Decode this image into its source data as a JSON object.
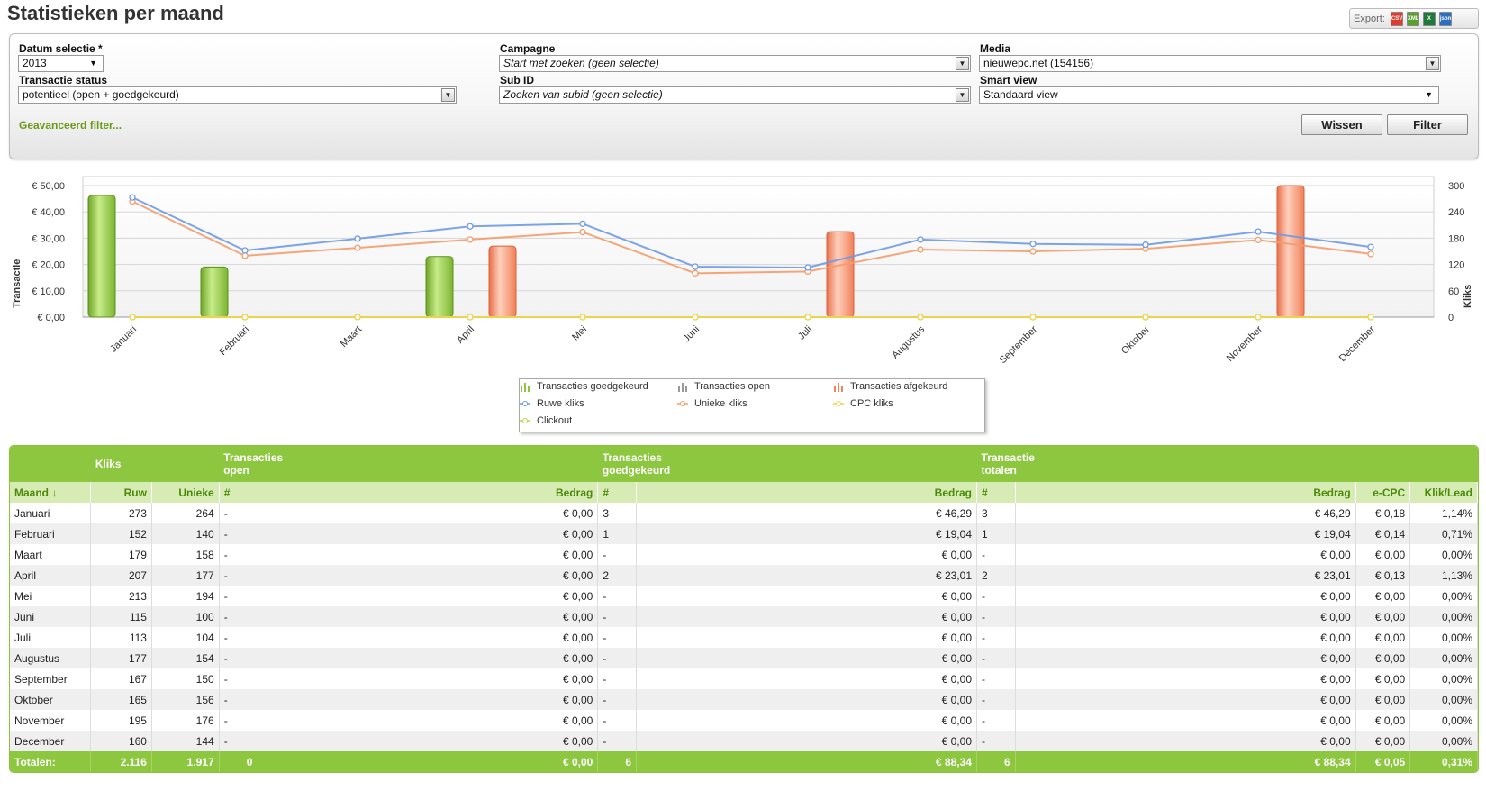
{
  "header": {
    "title": "Statistieken per maand",
    "export_label": "Export:",
    "export_icons": [
      "CSV",
      "XML",
      "X",
      "json"
    ]
  },
  "filters": {
    "datum_label": "Datum selectie *",
    "datum_value": "2013",
    "transactie_label": "Transactie status",
    "transactie_value": "potentieel (open + goedgekeurd)",
    "campagne_label": "Campagne",
    "campagne_value": "Start met zoeken (geen selectie)",
    "subid_label": "Sub ID",
    "subid_value": "Zoeken van subid (geen selectie)",
    "media_label": "Media",
    "media_value": "nieuwepc.net (154156)",
    "smartview_label": "Smart view",
    "smartview_value": "Standaard view",
    "advanced_link": "Geavanceerd filter...",
    "clear_button": "Wissen",
    "filter_button": "Filter"
  },
  "chart_data": {
    "type": "bar",
    "categories": [
      "Januari",
      "Februari",
      "Maart",
      "April",
      "Mei",
      "Juni",
      "Juli",
      "Augustus",
      "September",
      "Oktober",
      "November",
      "December"
    ],
    "ylabel": "Transactie",
    "y2label": "Kliks",
    "ylim": [
      0,
      50
    ],
    "y2lim": [
      0,
      300
    ],
    "y_ticks": [
      "€ 0,00",
      "€ 10,00",
      "€ 20,00",
      "€ 30,00",
      "€ 40,00",
      "€ 50,00"
    ],
    "y2_ticks": [
      "0",
      "60",
      "120",
      "180",
      "240",
      "300"
    ],
    "grid": true,
    "legend_position": "bottom-center",
    "series": [
      {
        "name": "Transacties goedgekeurd",
        "kind": "bar",
        "axis": "left",
        "color": "#8dc63f",
        "values": [
          46.29,
          19.04,
          0,
          23.01,
          0,
          0,
          0,
          0,
          0,
          0,
          0,
          0
        ]
      },
      {
        "name": "Transacties open",
        "kind": "bar",
        "axis": "left",
        "color": "#999999",
        "values": [
          0,
          0,
          0,
          0,
          0,
          0,
          0,
          0,
          0,
          0,
          0,
          0
        ]
      },
      {
        "name": "Transacties afgekeurd",
        "kind": "bar",
        "axis": "left",
        "color": "#f4825a",
        "values": [
          0,
          0,
          0,
          27,
          0,
          0,
          32.5,
          0,
          0,
          0,
          50,
          0
        ]
      },
      {
        "name": "Ruwe kliks",
        "kind": "line",
        "axis": "right",
        "color": "#6d9ae5",
        "values": [
          273,
          152,
          179,
          207,
          213,
          115,
          113,
          177,
          167,
          165,
          195,
          160
        ]
      },
      {
        "name": "Unieke kliks",
        "kind": "line",
        "axis": "right",
        "color": "#f39c6b",
        "values": [
          264,
          140,
          158,
          177,
          194,
          100,
          104,
          154,
          150,
          156,
          176,
          144
        ]
      },
      {
        "name": "CPC kliks",
        "kind": "line",
        "axis": "right",
        "color": "#f1d34a",
        "values": [
          0,
          0,
          0,
          0,
          0,
          0,
          0,
          0,
          0,
          0,
          0,
          0
        ]
      },
      {
        "name": "Clickout",
        "kind": "line",
        "axis": "right",
        "color": "#b4d948",
        "values": [
          0,
          0,
          0,
          0,
          0,
          0,
          0,
          0,
          0,
          0,
          0,
          0
        ]
      }
    ]
  },
  "table": {
    "group_headers": {
      "kliks": "Kliks",
      "open": "Transacties open",
      "goedgekeurd": "Transacties goedgekeurd",
      "totalen": "Transactie totalen"
    },
    "columns": [
      "Maand ↓",
      "Ruw",
      "Unieke",
      "#",
      "Bedrag",
      "#",
      "Bedrag",
      "#",
      "Bedrag",
      "e-CPC",
      "Klik/Lead"
    ],
    "rows": [
      [
        "Januari",
        "273",
        "264",
        "-",
        "€ 0,00",
        "3",
        "€ 46,29",
        "3",
        "€ 46,29",
        "€ 0,18",
        "1,14%"
      ],
      [
        "Februari",
        "152",
        "140",
        "-",
        "€ 0,00",
        "1",
        "€ 19,04",
        "1",
        "€ 19,04",
        "€ 0,14",
        "0,71%"
      ],
      [
        "Maart",
        "179",
        "158",
        "-",
        "€ 0,00",
        "-",
        "€ 0,00",
        "-",
        "€ 0,00",
        "€ 0,00",
        "0,00%"
      ],
      [
        "April",
        "207",
        "177",
        "-",
        "€ 0,00",
        "2",
        "€ 23,01",
        "2",
        "€ 23,01",
        "€ 0,13",
        "1,13%"
      ],
      [
        "Mei",
        "213",
        "194",
        "-",
        "€ 0,00",
        "-",
        "€ 0,00",
        "-",
        "€ 0,00",
        "€ 0,00",
        "0,00%"
      ],
      [
        "Juni",
        "115",
        "100",
        "-",
        "€ 0,00",
        "-",
        "€ 0,00",
        "-",
        "€ 0,00",
        "€ 0,00",
        "0,00%"
      ],
      [
        "Juli",
        "113",
        "104",
        "-",
        "€ 0,00",
        "-",
        "€ 0,00",
        "-",
        "€ 0,00",
        "€ 0,00",
        "0,00%"
      ],
      [
        "Augustus",
        "177",
        "154",
        "-",
        "€ 0,00",
        "-",
        "€ 0,00",
        "-",
        "€ 0,00",
        "€ 0,00",
        "0,00%"
      ],
      [
        "September",
        "167",
        "150",
        "-",
        "€ 0,00",
        "-",
        "€ 0,00",
        "-",
        "€ 0,00",
        "€ 0,00",
        "0,00%"
      ],
      [
        "Oktober",
        "165",
        "156",
        "-",
        "€ 0,00",
        "-",
        "€ 0,00",
        "-",
        "€ 0,00",
        "€ 0,00",
        "0,00%"
      ],
      [
        "November",
        "195",
        "176",
        "-",
        "€ 0,00",
        "-",
        "€ 0,00",
        "-",
        "€ 0,00",
        "€ 0,00",
        "0,00%"
      ],
      [
        "December",
        "160",
        "144",
        "-",
        "€ 0,00",
        "-",
        "€ 0,00",
        "-",
        "€ 0,00",
        "€ 0,00",
        "0,00%"
      ]
    ],
    "totals": [
      "Totalen:",
      "2.116",
      "1.917",
      "0",
      "€ 0,00",
      "6",
      "€ 88,34",
      "6",
      "€ 88,34",
      "€ 0,05",
      "0,31%"
    ]
  }
}
